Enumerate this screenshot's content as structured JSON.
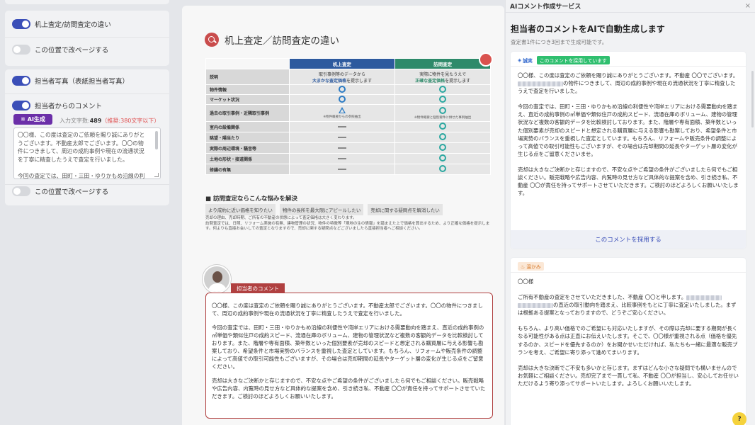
{
  "left_panel": {
    "toggle_compare": "机上査定/訪問査定の違い",
    "pagebreak_1": "この位置で改ページする",
    "toggle_photo": "担当者写真（表紙担当者写真）",
    "toggle_comment": "担当者からのコメント",
    "ai_button": "AI生成",
    "charcount_label": "入力文字数:",
    "charcount_value": "489",
    "charcount_recommend": "（推奨:380文字以下）",
    "textarea_text": "〇〇様、この度は査定のご依頼を賜り誠にありがとうございます。不動産太郎でございます。〇〇の物件につきまして、周辺の成約事例や現在の流通状況を丁寧に精査したうえで査定を行いました。\n\n今回の査定では、田町・三田・ゆりかもめ沿線の利",
    "pagebreak_2": "この位置で改ページする"
  },
  "preview": {
    "title": "机上査定／訪問査定の違い",
    "table": {
      "col1": "机上査定",
      "col2": "訪問査定",
      "desc_label": "説明",
      "desc_col1": "取引事例等のデータから",
      "desc_col1_hi": "大まかな査定価格",
      "desc_col1_tail": "を提示します",
      "desc_col2": "実際に物件を見たうえで",
      "desc_col2_hi": "正確な査定価格",
      "desc_col2_tail": "を提示します",
      "rows": [
        "物件情報",
        "マーケット状況",
        "過去の取引事例・近隣取引事例",
        "室内の設備関係",
        "眺望・陽当たり",
        "実際の周辺環境・騒音等",
        "土地の形状・接道関係",
        "修繕の有無"
      ],
      "note_col1": "※物件概要からの参照抽出",
      "note_col2": "※物件概要と個別要件に併せた事例抽出"
    },
    "worry_title": "■ 訪問査定ならこんな悩みを解決",
    "worry_tags": [
      "より成約に近い価格を知りたい",
      "物件の長所を最大限にアピールしたい",
      "売却に関する疑問点を解消したい"
    ],
    "worry_text": "売却の理由、売却時期、ご所有の不動産の状態によって査定価格は大きく変わります。\n訪問査定では、日照、リフォーム実施の有無、建物管理の状況、物件の特徴等「現地の生の情報」を踏まえた上で価格を算出するため、より正確な価格を提示します。何よりも直接お会いしての査定となりますので、売却に関する疑問点などございましたら直接担当者へご相談ください。",
    "comment_tab": "担当者のコメント",
    "comment_p1": "〇〇様、この度は査定のご依頼を賜り誠にありがとうございます。不動産太郎でございます。〇〇の物件につきまして、周辺の成約事例や現在の流通状況を丁寧に精査したうえで査定を行いました。",
    "comment_p2": "今回の査定では、田町・三田・ゆりかもめ沿線の利便性や湾岸エリアにおける需要動向を踏まえ、直近の成約事例の㎡単価や類似住戸の成約スピード、流通在庫のボリューム、建物の管理状況など複数の客観的データを比較検討しております。また、階層や専有面積、築年数といった個別要素が売却のスピードと想定される購買層に与える影響も勘案しており、希望条件と市場実勢のバランスを重視した査定としています。もちろん、リフォームや販売条件の調整によって高値での取引可能性もございますが、その場合は売却期間の延長やターゲット層の変化が生じる点をご留意ください。",
    "comment_p3": "売却は大きなご決断かと存じますので、不安な点やご希望の条件がございましたら何でもご相談ください。販売戦略や広告内容、内覧時の見せ方など具体的な提案を含め、引き続き私、不動産 〇〇が責任を持ってサポートさせていただきます。ご検討のほどよろしくお願いいたします。"
  },
  "drawer": {
    "header": "AIコメント作成サービス",
    "close_icon": "×",
    "title": "担当者のコメントをAIで自動生成します",
    "subtitle": "査定書1件につき3回まで生成可能です。",
    "option1": {
      "tag": "誠実",
      "adopted": "このコメントを採用しています",
      "p1_a": "〇〇様、この度は査定のご依頼を賜り誠にありがとうございます。不動産 〇〇でございます。",
      "p1_b": "の物件につきまして、周辺の成約事例や現在の流通状況を丁寧に精査したうえで査定を行いました。",
      "p2": "今回の査定では、田町・三田・ゆりかもめ沿線の利便性や湾岸エリアにおける需要動向を踏まえ、直近の成約事例の㎡単価や類似住戸の成約スピード、流通在庫のボリューム、建物の管理状況など複数の客観的データを比較検討しております。また、階層や専有面積、築年数といった個別要素が売却のスピードと想定される購買層に与える影響も勘案しており、希望条件と市場実勢のバランスを重視した査定としています。もちろん、リフォームや販売条件の調整によって高値での取引可能性もございますが、その場合は売却期間の延長やターゲット層の変化が生じる点をご留意くださいませ。",
      "p3": "売却は大きなご決断かと存じますので、不安な点やご希望の条件がございましたら何でもご相談ください。販売戦略や広告内容、内覧時の見せ方など具体的な提案を含め、引き続き私、不動産 〇〇が責任を持ってサポートさせていただきます。ご検討のほどよろしくお願いいたします。",
      "adopt_button": "このコメントを採用する"
    },
    "option2": {
      "tag": "温かみ",
      "greeting": "〇〇様",
      "p1_a": "ご所有不動産の査定をさせていただきました、不動産 〇〇と申します。",
      "p1_b": "の直近の取引動向を踏まえ、比較事例をもとに丁寧に査定いたしました。まずは根拠ある提案となっておりますので、どうぞご安心ください。",
      "p2": "もちろん、より高い価格でのご希望にも対応いたしますが、その際は売却に要する期間が長くなる可能性がある点は正直にお伝えいたします。そこで、〇〇様が重視される点（価格を優先するのか、スピードを優先するのか）をお聞かせいただければ、私たちも一緒に最適な販売プランを考え、ご希望に寄り添って進めてまいります。",
      "p3": "売却は大きな決断でご不安も多いかと存じます。まずはどんな小さな疑問でも構いませんのでお気軽にご相談ください。売却完了まで一貫して私、不動産 〇〇が担当し、安心してお任せいただけるよう寄り添ってサポートいたします。よろしくお願いいたします。"
    },
    "help_icon": "?"
  }
}
